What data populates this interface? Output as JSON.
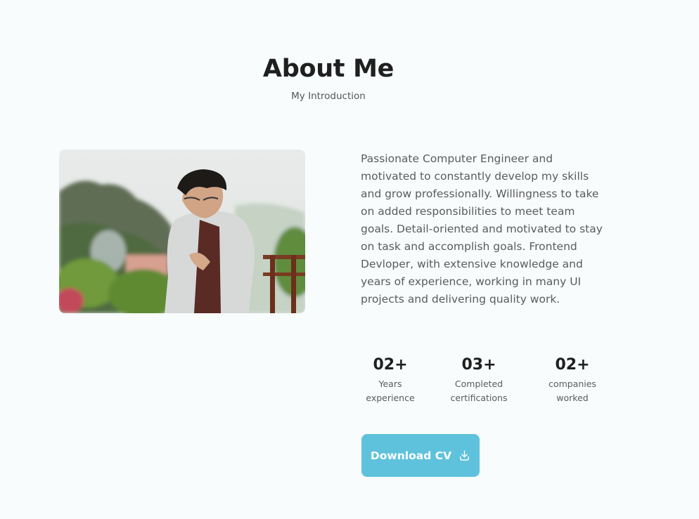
{
  "section": {
    "title": "About Me",
    "subtitle": "My Introduction"
  },
  "about": {
    "photo_icon": "portrait-photo",
    "description": "Passionate Computer Engineer and motivated to constantly develop my skills and grow professionally. Willingness to take on added responsibilities to meet team goals. Detail-oriented and motivated to stay on task and accomplish goals. Frontend Devloper, with extensive knowledge and years of experience, working in many UI projects and delivering quality work."
  },
  "stats": [
    {
      "number": "02+",
      "label_line1": "Years",
      "label_line2": "experience"
    },
    {
      "number": "03+",
      "label_line1": "Completed",
      "label_line2": "certifications"
    },
    {
      "number": "02+",
      "label_line1": "companies",
      "label_line2": "worked"
    }
  ],
  "download": {
    "label": "Download CV",
    "icon": "download-icon"
  },
  "colors": {
    "background": "#f8fcfd",
    "accent": "#5fc2dc",
    "title": "#1f1f1f",
    "text": "#5b5b5b"
  }
}
